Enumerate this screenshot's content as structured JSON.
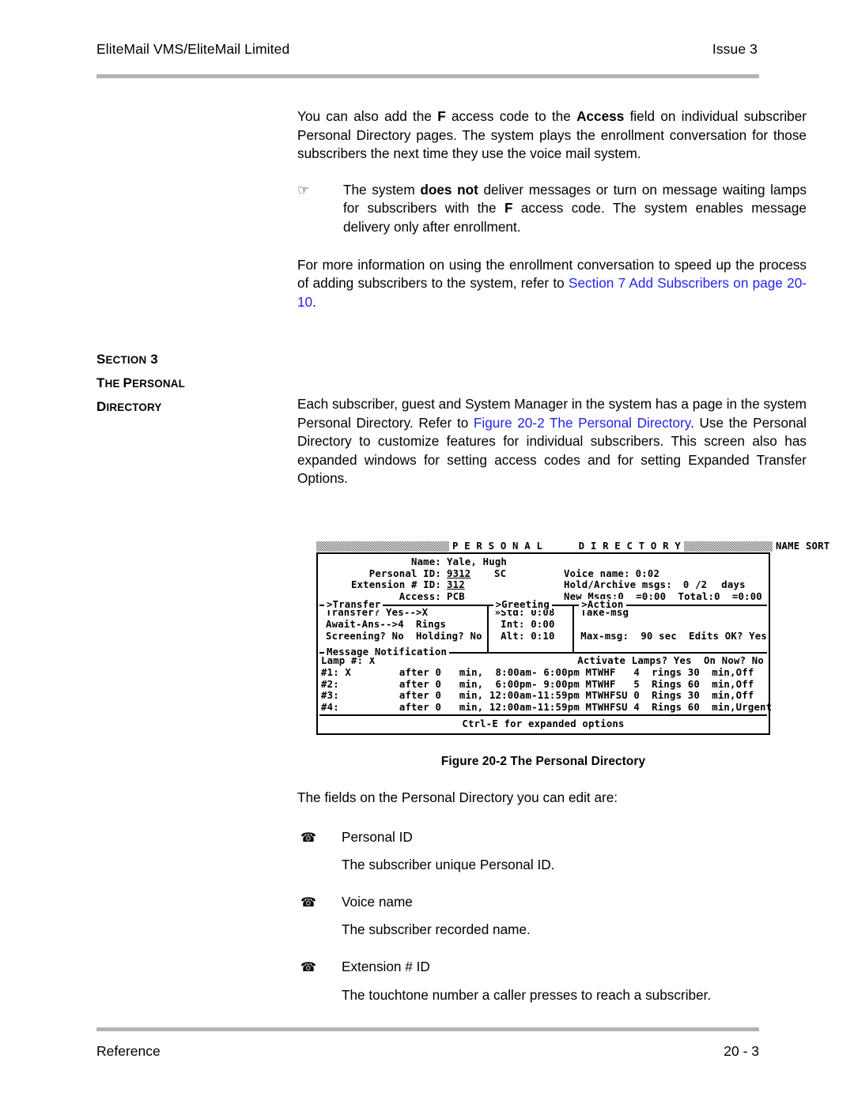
{
  "header": {
    "doc_title": "EliteMail VMS/EliteMail Limited",
    "issue": "Issue 3"
  },
  "body": {
    "para1_a": "You can also add the ",
    "para1_b": "F",
    "para1_c": " access code to the ",
    "para1_d": "Access",
    "para1_e": " field on individual subscriber Personal Directory pages. The system plays the enrollment conversation for those subscribers the next time they use the voice mail system.",
    "note_icon": "pointing-hand-icon",
    "note_a": "The system ",
    "note_b": "does not",
    "note_c": " deliver messages or turn on message waiting lamps for subscribers with the ",
    "note_d": "F",
    "note_e": " access code. The system enables message delivery only after enrollment.",
    "para2_a": "For more information on using the enrollment conversation to speed up the process of adding subscribers to the system, refer to ",
    "para2_link": "Section 7 Add Subscribers on page 20-10",
    "para2_b": "."
  },
  "section_heading": {
    "line1_caps": "S",
    "line1_rest": "ECTION",
    "line1_num": " 3",
    "line2_caps": "T",
    "line2_rest": "HE ",
    "line2_caps2": "P",
    "line2_rest2": "ERSONAL",
    "line3_caps": "D",
    "line3_rest": "IRECTORY"
  },
  "section_body": {
    "para_a": "Each subscriber, guest and System Manager in the system has a page in the system Personal Directory. Refer to ",
    "para_link": "Figure 20-2 The Personal Directory",
    "para_b": ". Use the Personal Directory to customize features for individual subscribers. This screen also has expanded windows for setting access codes and for setting Expanded Transfer Options."
  },
  "terminal": {
    "title": "P E R S O N A L      D I R E C T O R Y",
    "sort_mode": "NAME SORT",
    "fields": {
      "name_label": "Name:",
      "name_value": "Yale, Hugh",
      "personal_id_label": "Personal ID:",
      "personal_id_value": "9312",
      "sc_flag": "SC",
      "extension_label": "Extension # ID:",
      "extension_value": "312",
      "access_label": "Access:",
      "access_value": "PCB",
      "voice_name_label": "Voice name:",
      "voice_name_value": "0:02",
      "hold_archive_label": "Hold/Archive msgs:",
      "hold_archive_value": "0 /2",
      "hold_archive_unit": "days",
      "new_msgs_line": "New Msgs:0  =0:00  Total:0  =0:00"
    },
    "transfer_panel": {
      "label": ">Transfer",
      "line1": "Transfer? Yes-->X",
      "line2": "Await-Ans-->4  Rings",
      "line3": "Screening? No  Holding? No"
    },
    "greeting_panel": {
      "label": ">Greeting",
      "line1": "»Std: 0:08",
      "line2": " Int: 0:00",
      "line3": " Alt: 0:10"
    },
    "action_panel": {
      "label": ">Action",
      "line1": "Take-msg",
      "line2": "",
      "line3": "Max-msg:  90 sec  Edits OK? Yes"
    },
    "notification": {
      "label": "Message Notification",
      "lamp_label": "Lamp #: X",
      "activate_lamps": "Activate Lamps? Yes  On Now? No",
      "rows": [
        "#1: X        after 0   min,  8:00am- 6:00pm MTWHF   4  rings 30  min,Off",
        "#2:          after 0   min,  6:00pm- 9:00pm MTWHF   5  Rings 60  min,Off",
        "#3:          after 0   min, 12:00am-11:59pm MTWHFSU 0  Rings 30  min,Off",
        "#4:          after 0   min, 12:00am-11:59pm MTWHFSU 4  Rings 60  min,Urgent"
      ]
    },
    "status_line": "Ctrl-E for expanded options"
  },
  "figure_caption": "Figure 20-2   The Personal Directory",
  "list": {
    "intro": "The fields on the Personal Directory you can edit are:",
    "bullet_glyph": "✆",
    "items": [
      {
        "term": "Personal ID",
        "desc": "The subscriber unique Personal ID."
      },
      {
        "term": "Voice name",
        "desc": "The subscriber recorded name."
      },
      {
        "term": "Extension # ID",
        "desc": "The touchtone number a caller presses to reach a subscriber."
      }
    ]
  },
  "footer": {
    "left": "Reference",
    "right": "20 - 3"
  },
  "colors": {
    "link": "#2424EF",
    "rule": "#B3B3B3",
    "text": "#000000"
  }
}
